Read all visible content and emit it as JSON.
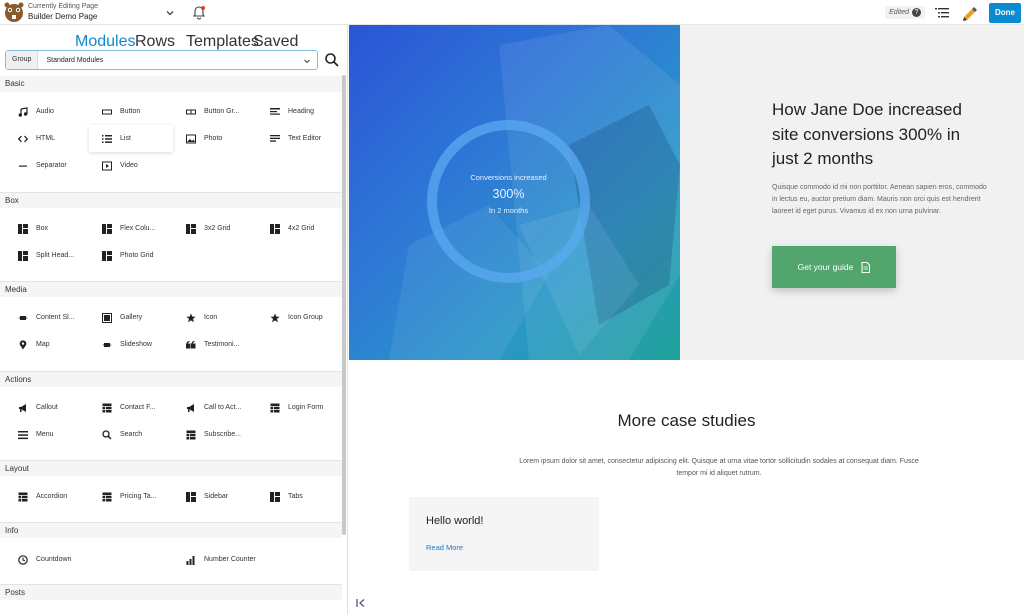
{
  "topbar": {
    "editing_label": "Currently Editing Page",
    "page_name": "Builder Demo Page",
    "edited_label": "Edited",
    "done_label": "Done"
  },
  "panel": {
    "tabs": [
      "Modules",
      "Rows",
      "Templates",
      "Saved"
    ],
    "group_label": "Group",
    "group_value": "Standard Modules",
    "sections": {
      "basic": "Basic",
      "box": "Box",
      "media": "Media",
      "actions": "Actions",
      "layout": "Layout",
      "info": "Info",
      "posts": "Posts"
    },
    "modules": {
      "audio": "Audio",
      "button": "Button",
      "button_group": "Button Gr...",
      "heading": "Heading",
      "html": "HTML",
      "list": "List",
      "photo": "Photo",
      "text_editor": "Text Editor",
      "separator": "Separator",
      "video": "Video",
      "box": "Box",
      "flex_columns": "Flex Colu...",
      "grid_3x2": "3x2 Grid",
      "grid_4x2": "4x2 Grid",
      "split_header": "Split Head...",
      "photo_grid": "Photo Grid",
      "content_slider": "Content Sl...",
      "gallery": "Gallery",
      "icon": "Icon",
      "icon_group": "Icon Group",
      "map": "Map",
      "slideshow": "Slideshow",
      "testimonials": "Testimoni...",
      "callout": "Callout",
      "contact_form": "Contact F...",
      "call_to_action": "Call to Act...",
      "login_form": "Login Form",
      "menu": "Menu",
      "search": "Search",
      "subscribe": "Subscribe...",
      "accordion": "Accordion",
      "pricing_table": "Pricing Ta...",
      "sidebar": "Sidebar",
      "tabs": "Tabs",
      "countdown": "Countdown",
      "number_counter": "Number Counter"
    }
  },
  "hero": {
    "ring_line1": "Conversions increased",
    "ring_value": "300%",
    "ring_line3": "In 2 months",
    "heading": "How Jane Doe increased site conversions 300% in just 2 months",
    "paragraph": "Quisque commodo id mi non porttitor. Aenean sapien eros, commodo in lectus eu, auctor pretium diam. Mauris non orci quis est hendrerit laoreet id eget purus. Vivamus id ex non urna pulvinar.",
    "cta_label": "Get your guide"
  },
  "case_studies": {
    "heading": "More case studies",
    "paragraph": "Lorem ipsum dolor sit amet, consectetur adipiscing elit. Quisque at urna vitae tortor sollicitudin sodales at consequat diam. Fusce tempor mi id aliquet rutrum.",
    "card_title": "Hello world!",
    "card_link": "Read More"
  },
  "colors": {
    "accent": "#0a8ad0",
    "cta": "#53a56e",
    "link": "#2277bb"
  }
}
